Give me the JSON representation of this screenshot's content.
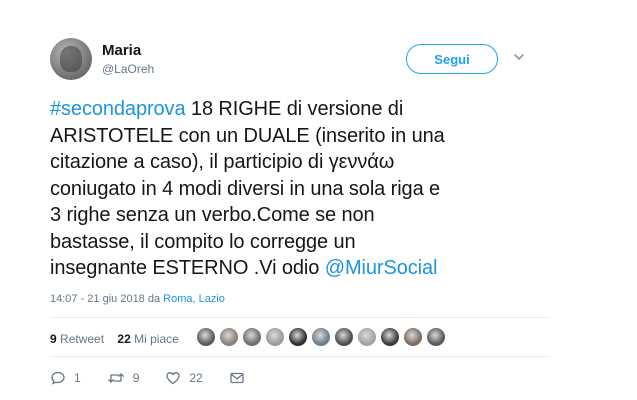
{
  "user": {
    "name": "Maria",
    "handle": "@LaOreh"
  },
  "follow_label": "Segui",
  "tweet_lines": [
    [
      {
        "text": "#secondaprova",
        "link": true
      },
      {
        "text": " 18 RIGHE di versione di",
        "link": false
      }
    ],
    [
      {
        "text": "ARISTOTELE con un DUALE (inserito in una",
        "link": false
      }
    ],
    [
      {
        "text": "citazione a caso), il participio di γεννάω",
        "link": false
      }
    ],
    [
      {
        "text": "coniugato in 4 modi diversi in una sola riga e",
        "link": false
      }
    ],
    [
      {
        "text": "3 righe senza un verbo.Come se non",
        "link": false
      }
    ],
    [
      {
        "text": "bastasse, il compito lo corregge un",
        "link": false
      }
    ],
    [
      {
        "text": "insegnante ESTERNO .Vi odio ",
        "link": false
      },
      {
        "text": "@MiurSocial",
        "link": true
      }
    ]
  ],
  "meta": {
    "time_date": "14:07 - 21 giu 2018 da ",
    "place": "Roma, Lazio"
  },
  "stats": {
    "retweets_count": "9",
    "retweets_label": "Retweet",
    "likes_count": "22",
    "likes_label": "Mi piace"
  },
  "liker_avatar_colors": [
    "#5a5a5a",
    "#8a7f78",
    "#6e6e6e",
    "#9c9c9c",
    "#2f2f2f",
    "#6f7c8a",
    "#4d4d4d",
    "#a2a2a2",
    "#3b3b3b",
    "#7a6c62",
    "#595959"
  ],
  "actions": {
    "replies": "1",
    "retweets": "9",
    "likes": "22"
  },
  "colors": {
    "accent": "#1da1f2",
    "link": "#1b95e0",
    "muted": "#657786"
  }
}
